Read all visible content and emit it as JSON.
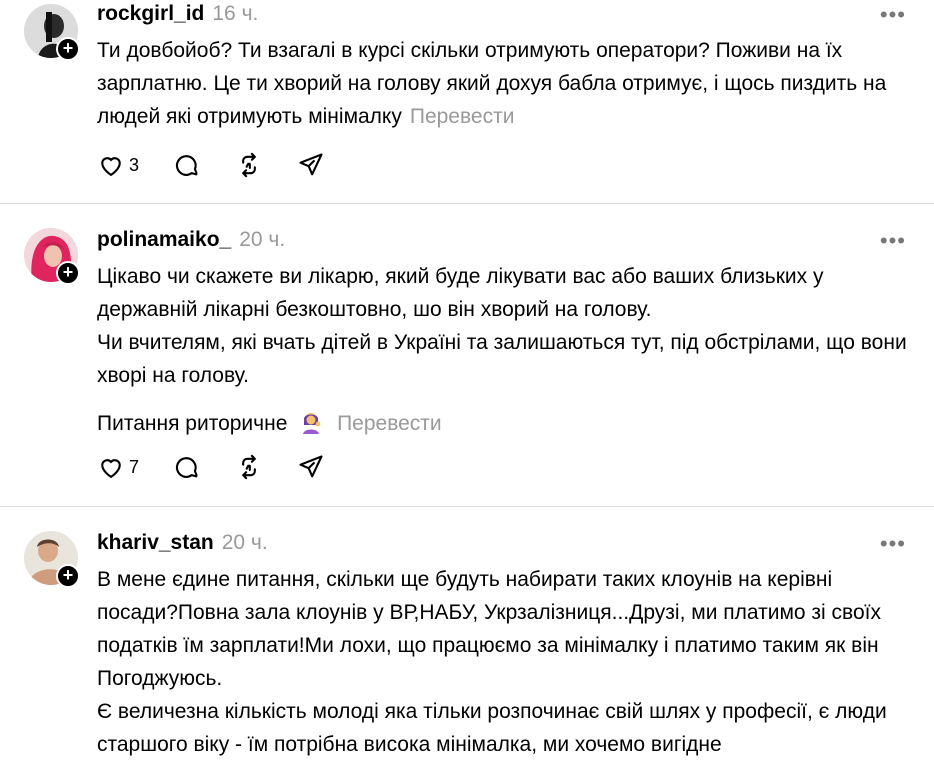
{
  "posts": [
    {
      "username": "rockgirl_id",
      "time": "16 ч.",
      "more": "•••",
      "paragraphs": [
        "Ти довбойоб? Ти взагалі в курсі скільки отримують оператори? Поживи на їх зарплатню. Це ти хворий на голову який дохуя бабла отримує, і щось пиздить на людей які отримують мінімалку"
      ],
      "translate": "Перевести",
      "likes": "3"
    },
    {
      "username": "polinamaiko_",
      "time": "20 ч.",
      "more": "•••",
      "paragraphs": [
        "Цікаво чи скажете ви лікарю, який буде лікувати вас або ваших близьких у державній лікарні безкоштовно, шо він хворий на голову.",
        "Чи вчителям, які вчать дітей в Україні та залишаються тут, під обстрілами, що вони хворі на голову."
      ],
      "last_line": "Питання риторичне",
      "emoji": "person-tipping-hand-emoji",
      "translate": "Перевести",
      "likes": "7"
    },
    {
      "username": "khariv_stan",
      "time": "20 ч.",
      "more": "•••",
      "paragraphs": [
        "В мене єдине питання, скільки ще будуть набирати таких клоунів на керівні посади?Повна зала клоунів у ВР,НАБУ, Укрзалізниця...Друзі, ми платимо зі своїх податків їм зарплати!Ми лохи, що працюємо за мінімалку і платимо таким як він Погоджуюсь.",
        "Є величезна кількість молоді яка тільки розпочинає свій шлях у професії, є люди старшого віку - їм потрібна висока мінімалка, ми хочемо вигідне"
      ]
    }
  ],
  "icons": {
    "like": "heart-icon",
    "comment": "comment-icon",
    "repost": "repost-icon",
    "share": "share-icon",
    "follow": "plus-icon"
  }
}
